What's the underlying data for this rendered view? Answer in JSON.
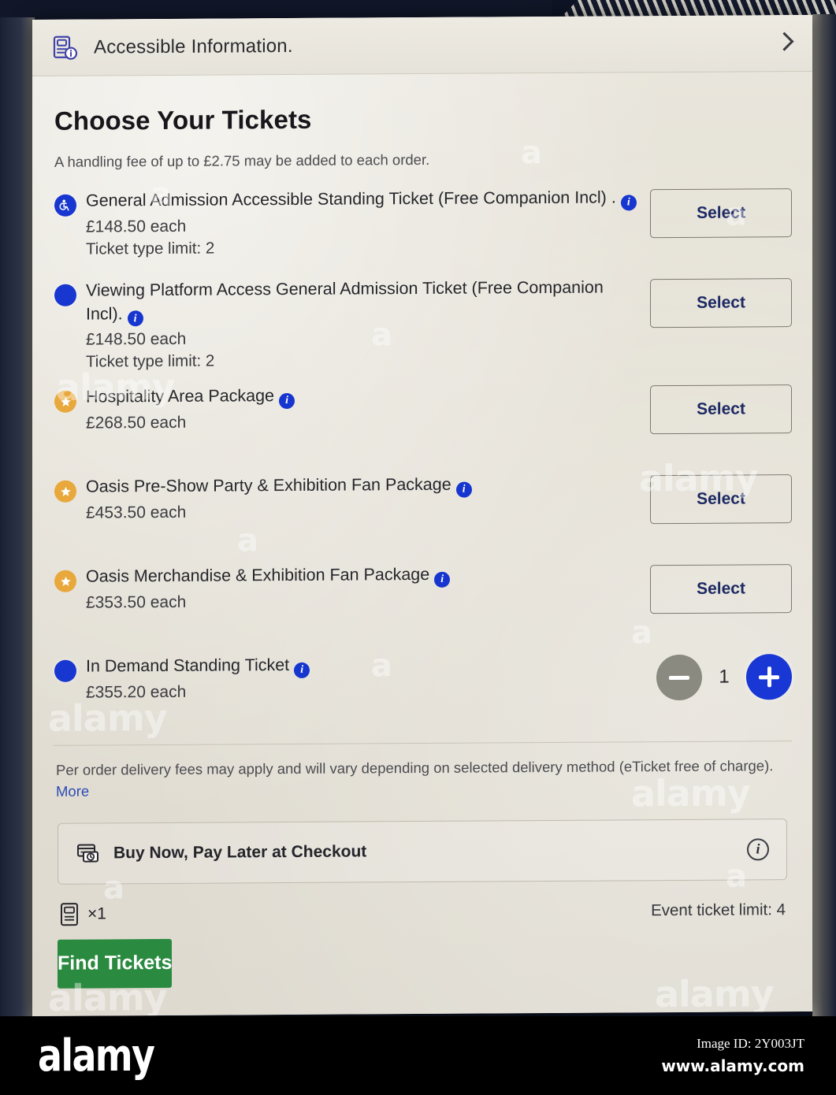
{
  "accessible_bar": {
    "icon": "accessible-information-icon",
    "label": "Accessible Information.",
    "chevron": "chevron-right-icon"
  },
  "page": {
    "title": "Choose Your Tickets",
    "handling_fee": "A handling fee of up to £2.75 may be added to each order."
  },
  "tickets": [
    {
      "badge": "accessible",
      "badge_color": "#1836d0",
      "name": "General Admission Accessible Standing Ticket (Free Companion Incl) .",
      "price": "£148.50 each",
      "limit": "Ticket type limit: 2",
      "action": "Select"
    },
    {
      "badge": "dot",
      "badge_color": "#1836d0",
      "name": "Viewing Platform Access General Admission Ticket (Free Companion Incl).",
      "price": "£148.50 each",
      "limit": "Ticket type limit: 2",
      "action": "Select"
    },
    {
      "badge": "star",
      "badge_color": "#e8a83b",
      "name": "Hospitality Area Package",
      "price": "£268.50 each",
      "limit": "",
      "action": "Select"
    },
    {
      "badge": "star",
      "badge_color": "#e8a83b",
      "name": "Oasis Pre-Show Party & Exhibition Fan Package",
      "price": "£453.50 each",
      "limit": "",
      "action": "Select"
    },
    {
      "badge": "star",
      "badge_color": "#e8a83b",
      "name": "Oasis Merchandise & Exhibition Fan Package",
      "price": "£353.50 each",
      "limit": "",
      "action": "Select"
    },
    {
      "badge": "dot",
      "badge_color": "#1836d0",
      "name": "In Demand Standing Ticket",
      "price": "£355.20 each",
      "limit": "",
      "action": "stepper",
      "quantity": "1"
    }
  ],
  "fees": {
    "note": "Per order delivery fees may apply and will vary depending on selected delivery method (eTicket free of charge).",
    "more_link": "More"
  },
  "bnpl": {
    "icon": "buy-now-pay-later-icon",
    "label": "Buy Now, Pay Later at Checkout",
    "info_icon": "info-circle-icon"
  },
  "summary": {
    "icon": "ticket-icon",
    "count": "×1",
    "limit": "Event ticket limit: 4"
  },
  "cta": {
    "label": "Find Tickets",
    "color": "#2a8a3f"
  },
  "watermark": {
    "logo": "alamy",
    "image_id": "Image ID: 2Y003JT",
    "url": "www.alamy.com"
  }
}
